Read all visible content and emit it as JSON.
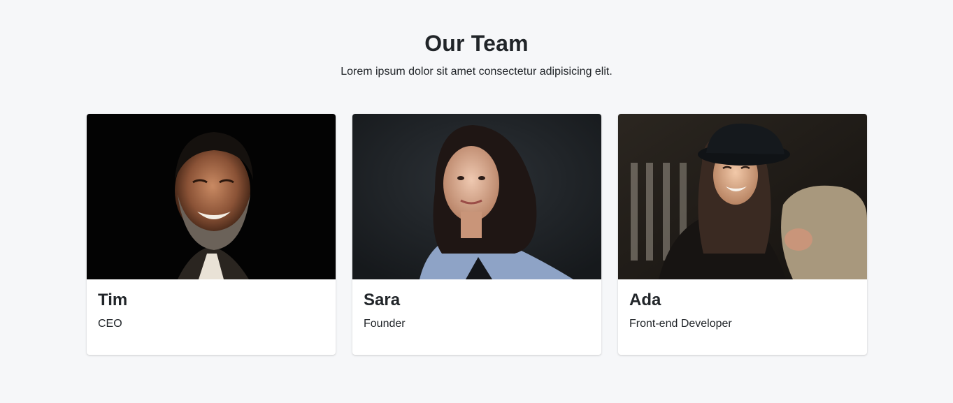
{
  "section": {
    "title": "Our Team",
    "subtitle": "Lorem ipsum dolor sit amet consectetur adipisicing elit."
  },
  "team": [
    {
      "name": "Tim",
      "role": "CEO"
    },
    {
      "name": "Sara",
      "role": "Founder"
    },
    {
      "name": "Ada",
      "role": "Front-end Developer"
    }
  ],
  "colors": {
    "page_background": "#f6f7f9",
    "card_background": "#ffffff",
    "text": "#212529"
  }
}
